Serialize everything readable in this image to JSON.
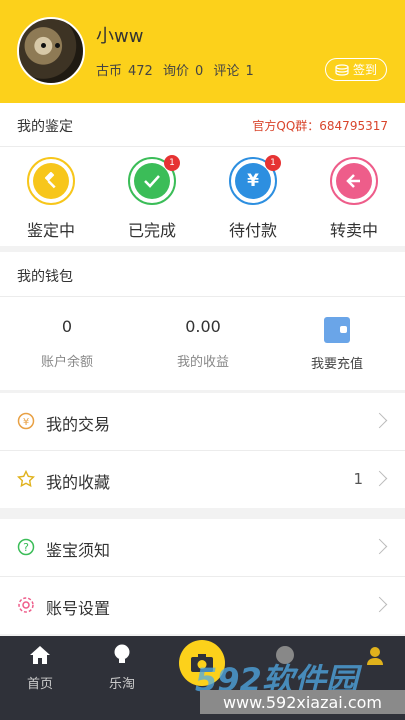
{
  "profile": {
    "username": "小ww",
    "coins_label": "古币",
    "coins_value": "472",
    "inquiry_label": "询价",
    "inquiry_value": "0",
    "comment_label": "评论",
    "comment_value": "1",
    "sign_label": "签到"
  },
  "appraisal": {
    "title": "我的鉴定",
    "qq_group": "官方QQ群：684795317",
    "items": [
      {
        "label": "鉴定中",
        "icon": "gavel-icon",
        "color": "#f7c61b",
        "badge": ""
      },
      {
        "label": "已完成",
        "icon": "check-icon",
        "color": "#3bbd58",
        "badge": "1"
      },
      {
        "label": "待付款",
        "icon": "yen-icon",
        "color": "#2d8fe0",
        "badge": "1"
      },
      {
        "label": "转卖中",
        "icon": "back-arrow-icon",
        "color": "#ee5d8a",
        "badge": ""
      }
    ]
  },
  "wallet": {
    "title": "我的钱包",
    "balance_value": "0",
    "balance_label": "账户余额",
    "income_value": "0.00",
    "income_label": "我的收益",
    "recharge_label": "我要充值"
  },
  "menu": {
    "trade": "我的交易",
    "favorites": "我的收藏",
    "favorites_count": "1",
    "notice": "鉴宝须知",
    "settings": "账号设置"
  },
  "tabbar": {
    "home": "首页",
    "letao": "乐淘"
  },
  "watermark": {
    "brand": "592软件园",
    "url": "www.592xiazai.com"
  }
}
